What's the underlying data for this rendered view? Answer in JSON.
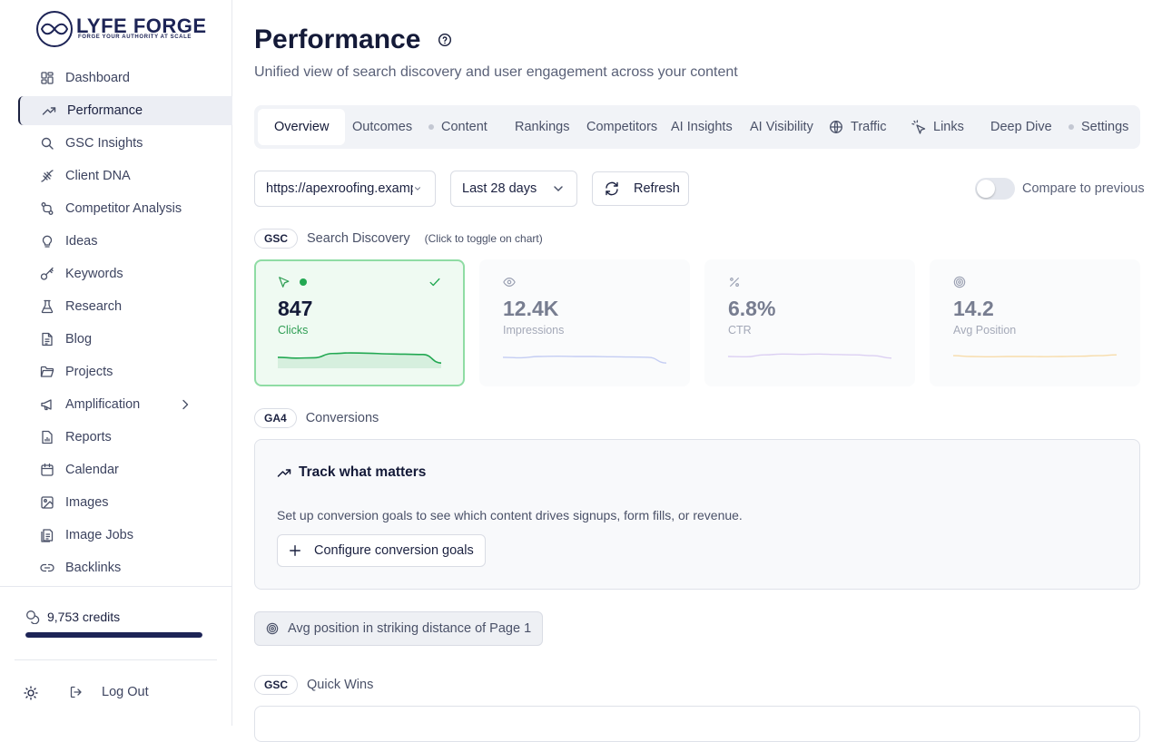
{
  "brand": {
    "name": "LYFE FORGE",
    "tagline": "FORGE YOUR AUTHORITY AT SCALE"
  },
  "sidebar": {
    "items": [
      {
        "label": "Dashboard",
        "icon": "dashboard-icon"
      },
      {
        "label": "Performance",
        "icon": "trending-up-icon",
        "active": true
      },
      {
        "label": "GSC Insights",
        "icon": "search-icon"
      },
      {
        "label": "Client DNA",
        "icon": "dna-icon"
      },
      {
        "label": "Competitor Analysis",
        "icon": "git-compare-icon"
      },
      {
        "label": "Ideas",
        "icon": "lightbulb-icon"
      },
      {
        "label": "Keywords",
        "icon": "key-icon"
      },
      {
        "label": "Research",
        "icon": "flask-icon"
      },
      {
        "label": "Blog",
        "icon": "document-icon"
      },
      {
        "label": "Projects",
        "icon": "folder-icon"
      },
      {
        "label": "Amplification",
        "icon": "megaphone-icon",
        "expandable": true
      },
      {
        "label": "Reports",
        "icon": "report-icon"
      },
      {
        "label": "Calendar",
        "icon": "calendar-icon"
      },
      {
        "label": "Images",
        "icon": "image-icon"
      },
      {
        "label": "Image Jobs",
        "icon": "image-jobs-icon"
      },
      {
        "label": "Backlinks",
        "icon": "link-icon"
      }
    ],
    "credits_label": "9,753 credits",
    "credits_fraction": 1.0,
    "logout_label": "Log Out"
  },
  "header": {
    "title": "Performance",
    "subtitle": "Unified view of search discovery and user engagement across your content"
  },
  "tabs": [
    {
      "label": "Overview",
      "active": true
    },
    {
      "label": "Outcomes"
    },
    {
      "label": "Content",
      "icon": "dot"
    },
    {
      "label": "Rankings"
    },
    {
      "label": "Competitors"
    },
    {
      "label": "AI Insights"
    },
    {
      "label": "AI Visibility"
    },
    {
      "label": "Traffic",
      "icon": "globe-icon"
    },
    {
      "label": "Links",
      "icon": "pointer-click-icon"
    },
    {
      "label": "Deep Dive"
    },
    {
      "label": "Settings",
      "icon": "dot"
    }
  ],
  "filters": {
    "site_value": "https://apexroofing.examp",
    "date_range": "Last 28 days",
    "refresh_label": "Refresh",
    "compare_label": "Compare to previous",
    "compare_on": false
  },
  "search_discovery": {
    "badge": "GSC",
    "title": "Search Discovery",
    "hint": "(Click to toggle on chart)",
    "metrics": [
      {
        "value": "847",
        "label": "Clicks",
        "icon": "cursor-icon",
        "active": true,
        "color": "#22a852",
        "trend": [
          0.45,
          0.4,
          0.42,
          0.68,
          0.72,
          0.7,
          0.66,
          0.64,
          0.62,
          0.1
        ]
      },
      {
        "value": "12.4K",
        "label": "Impressions",
        "icon": "eye-icon",
        "active": false,
        "color": "#c4cdf3",
        "trend": [
          0.45,
          0.42,
          0.5,
          0.52,
          0.5,
          0.5,
          0.48,
          0.47,
          0.45,
          0.1
        ]
      },
      {
        "value": "6.8%",
        "label": "CTR",
        "icon": "percent-icon",
        "active": false,
        "color": "#dcd0f3",
        "trend": [
          0.5,
          0.48,
          0.6,
          0.65,
          0.63,
          0.65,
          0.62,
          0.6,
          0.55,
          0.4
        ]
      },
      {
        "value": "14.2",
        "label": "Avg Position",
        "icon": "target-icon",
        "active": false,
        "color": "#f7dcaa",
        "trend": [
          0.55,
          0.5,
          0.48,
          0.5,
          0.5,
          0.49,
          0.5,
          0.52,
          0.55,
          0.6
        ]
      }
    ]
  },
  "conversions": {
    "badge": "GA4",
    "title": "Conversions",
    "card_title": "Track what matters",
    "description": "Set up conversion goals to see which content drives signups, form fills, or revenue.",
    "button_label": "Configure conversion goals"
  },
  "striking": {
    "label": "Avg position in striking distance of Page 1"
  },
  "quick_wins": {
    "badge": "GSC",
    "title": "Quick Wins"
  }
}
